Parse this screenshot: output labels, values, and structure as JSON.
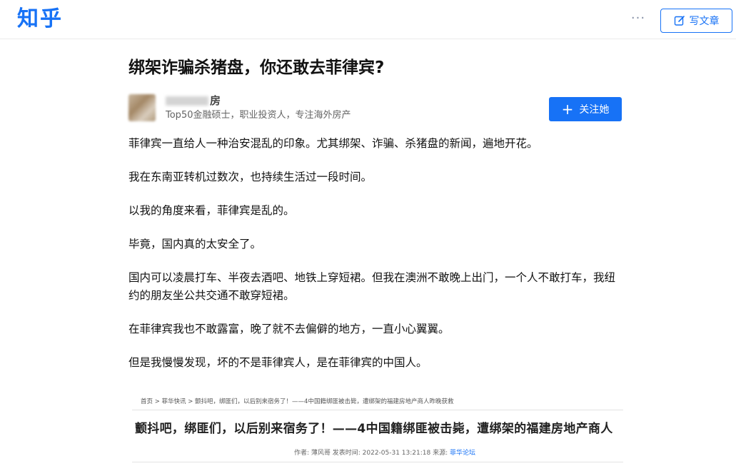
{
  "header": {
    "logo_text": "知乎",
    "more_label": "···",
    "write_label": "写文章"
  },
  "article": {
    "title": "绑架诈骗杀猪盘，你还敢去菲律宾?",
    "author": {
      "name_visible": "房",
      "bio": "Top50金融硕士，职业投资人，专注海外房产",
      "follow_label": "关注她"
    },
    "paragraphs": [
      "菲律宾一直给人一种治安混乱的印象。尤其绑架、诈骗、杀猪盘的新闻，遍地开花。",
      "我在东南亚转机过数次，也持续生活过一段时间。",
      "以我的角度来看，菲律宾是乱的。",
      "毕竟，国内真的太安全了。",
      "国内可以凌晨打车、半夜去酒吧、地铁上穿短裙。但我在澳洲不敢晚上出门，一个人不敢打车，我纽约的朋友坐公共交通不敢穿短裙。",
      "在菲律宾我也不敢露富，晚了就不去偏僻的地方，一直小心翼翼。",
      "但是我慢慢发现，坏的不是菲律宾人，是在菲律宾的中国人。"
    ],
    "embedded_screenshot": {
      "breadcrumb": "首页 > 菲华快讯 > 颤抖吧，绑匪们，以后别来宿务了！——4中国籍绑匪被击毙，遭绑架的福建房地产商人昨晚获救",
      "headline": "颤抖吧，绑匪们，以后别来宿务了！——4中国籍绑匪被击毙，遭绑架的福建房地产商人",
      "meta_prefix": "作者:  薄风哥  发表时间:  2022-05-31 13:21:18  来源:  ",
      "meta_source": "菲华论坛"
    }
  },
  "colors": {
    "brand": "#1772f6",
    "text": "#121212",
    "muted": "#646464"
  }
}
